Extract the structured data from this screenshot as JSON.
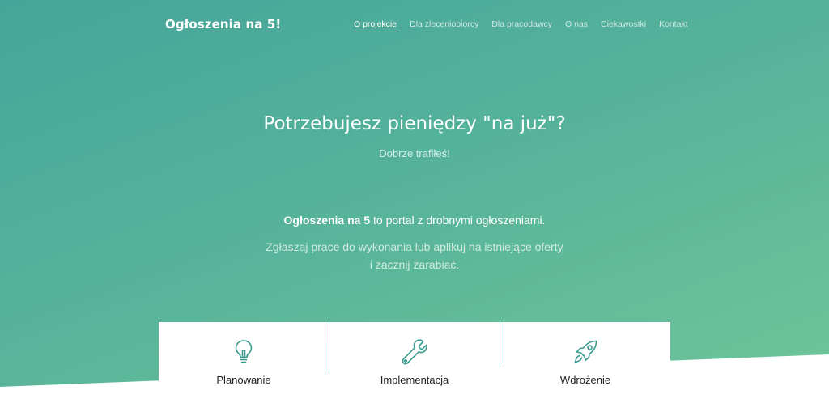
{
  "brand": {
    "name": "Ogłoszenia na 5!"
  },
  "nav": {
    "items": [
      {
        "label": "O projekcie",
        "active": true
      },
      {
        "label": "Dla zleceniobiorcy",
        "active": false
      },
      {
        "label": "Dla pracodawcy",
        "active": false
      },
      {
        "label": "O nas",
        "active": false
      },
      {
        "label": "Ciekawostki",
        "active": false
      },
      {
        "label": "Kontakt",
        "active": false
      }
    ]
  },
  "hero": {
    "headline": "Potrzebujesz pieniędzy \"na już\"?",
    "subheadline": "Dobrze trafiłeś!",
    "intro_bold": "Ogłoszenia na 5",
    "intro_rest": " to portal z drobnymi ogłoszeniami.",
    "desc_line1": "Zgłaszaj prace do wykonania lub aplikuj na istniejące oferty",
    "desc_line2": "i zacznij zarabiać."
  },
  "features": [
    {
      "title": "Planowanie",
      "icon": "lightbulb-icon"
    },
    {
      "title": "Implementacja",
      "icon": "wrench-icon"
    },
    {
      "title": "Wdrożenie",
      "icon": "rocket-icon"
    }
  ],
  "colors": {
    "gradient_start": "#45a59a",
    "gradient_end": "#6ec59a",
    "icon_accent": "#3a9a8e",
    "card_bg": "#ffffff"
  }
}
